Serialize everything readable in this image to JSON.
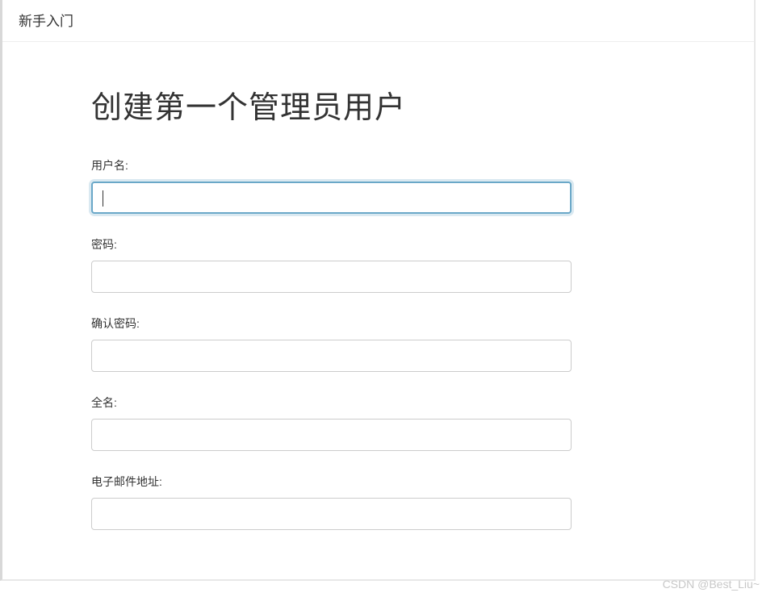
{
  "header": {
    "title": "新手入门"
  },
  "page": {
    "title": "创建第一个管理员用户"
  },
  "form": {
    "username": {
      "label": "用户名:",
      "value": ""
    },
    "password": {
      "label": "密码:",
      "value": ""
    },
    "confirm_password": {
      "label": "确认密码:",
      "value": ""
    },
    "fullname": {
      "label": "全名:",
      "value": ""
    },
    "email": {
      "label": "电子邮件地址:",
      "value": ""
    }
  },
  "watermark": "CSDN @Best_Liu~"
}
